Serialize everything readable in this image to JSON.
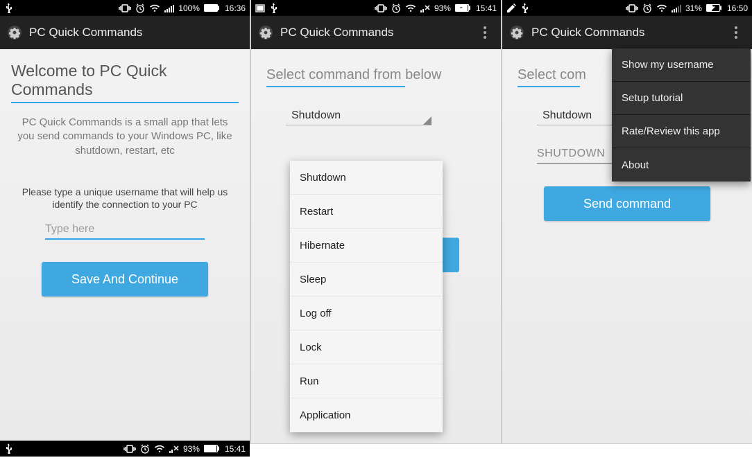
{
  "app_title": "PC Quick Commands",
  "colors": {
    "accent": "#3fa8e0",
    "accent_line": "#32a6e8",
    "appbar": "#222222"
  },
  "icons": {
    "usb": "usb-icon",
    "vibrate": "vibrate-icon",
    "alarm": "alarm-icon",
    "wifi": "wifi-icon",
    "signal": "signal-icon",
    "battery": "battery-icon",
    "screenshot": "screenshot-icon",
    "edit": "edit-icon",
    "nosignal": "no-signal-icon",
    "gear": "gear-icon",
    "overflow": "overflow-icon"
  },
  "screen1": {
    "status": {
      "left": [
        "usb"
      ],
      "right_icons": [
        "vibrate",
        "alarm",
        "wifi",
        "signal"
      ],
      "battery": "100%",
      "time": "16:36"
    },
    "heading": "Welcome to PC Quick Commands",
    "description": "PC Quick Commands is a small app that lets you send commands to your Windows PC, like shutdown, restart, etc",
    "instruction": "Please type a unique username that will help us identify the connection to your PC",
    "input_placeholder": "Type here",
    "button": "Save And Continue"
  },
  "screen2": {
    "status": {
      "left": [
        "screenshot",
        "usb"
      ],
      "right_icons": [
        "vibrate",
        "alarm",
        "wifi",
        "nosignal"
      ],
      "battery": "93%",
      "time": "15:41"
    },
    "section_title": "Select command from below",
    "selected": "Shutdown",
    "dropdown_items": [
      "Shutdown",
      "Restart",
      "Hibernate",
      "Sleep",
      "Log off",
      "Lock",
      "Run",
      "Application"
    ]
  },
  "screen3": {
    "status": {
      "left": [
        "edit",
        "usb"
      ],
      "right_icons": [
        "vibrate",
        "alarm",
        "wifi",
        "signal"
      ],
      "battery": "31%",
      "time": "16:50"
    },
    "section_title": "Select command from below",
    "section_title_clipped": "Select com",
    "selected": "Shutdown",
    "second_input": "SHUTDOWN",
    "button": "Send command",
    "menu_items": [
      "Show my username",
      "Setup tutorial",
      "Rate/Review this app",
      "About"
    ]
  },
  "bottom_fragment": {
    "status": {
      "left": [
        "usb"
      ],
      "right_icons": [
        "vibrate",
        "alarm",
        "wifi",
        "nosignal"
      ],
      "battery": "93%",
      "time": "15:41"
    }
  }
}
